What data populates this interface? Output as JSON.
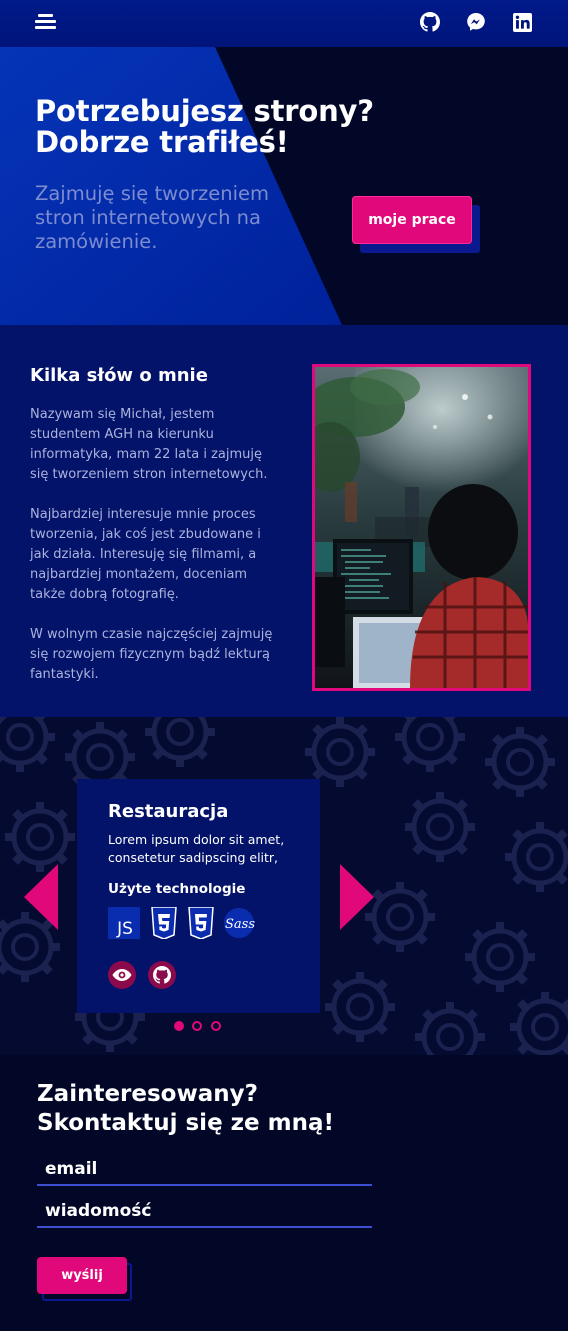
{
  "nav": {
    "menu_icon": "hamburger-icon",
    "social": [
      {
        "name": "github",
        "icon": "github-icon"
      },
      {
        "name": "messenger",
        "icon": "messenger-icon"
      },
      {
        "name": "linkedin",
        "icon": "linkedin-icon"
      }
    ]
  },
  "hero": {
    "title_line1": "Potrzebujesz strony?",
    "title_line2": "Dobrze trafiłeś!",
    "subtitle": "Zajmuję się tworzeniem stron internetowych na zamówienie.",
    "cta_label": "moje prace"
  },
  "about": {
    "title": "Kilka słów o mnie",
    "paragraphs": [
      "Nazywam się Michał, jestem studentem AGH na kierunku informatyka, mam 22 lata i zajmuję się tworzeniem stron internetowych.",
      "Najbardziej interesuje mnie proces tworzenia, jak coś jest zbudowane i jak działa. Interesuję się filmami, a najbardziej montażem, doceniam także dobrą fotografię.",
      "W wolnym czasie najczęściej zajmuję się rozwojem fizycznym bądź lekturą fantastyki."
    ]
  },
  "project": {
    "title": "Restauracja",
    "description": "Lorem ipsum dolor sit amet, consetetur sadipscing elitr,",
    "tech_heading": "Użyte technologie",
    "tech": [
      {
        "name": "JS",
        "icon": "js-icon"
      },
      {
        "name": "CSS3",
        "icon": "css3-icon"
      },
      {
        "name": "HTML5",
        "icon": "html5-icon"
      },
      {
        "name": "Sass",
        "icon": "sass-icon"
      }
    ],
    "actions": [
      {
        "icon": "eye-icon"
      },
      {
        "icon": "github-icon"
      }
    ],
    "slider": {
      "slides": 3,
      "active": 1
    }
  },
  "contact": {
    "title_line1": "Zainteresowany?",
    "title_line2": "Skontaktuj się ze mną!",
    "email_label": "email",
    "message_label": "wiadomość",
    "send_label": "wyślij"
  },
  "colors": {
    "accent": "#e0087a",
    "navy": "#04136a",
    "background": "#020728",
    "underline": "#3d4fd0"
  }
}
